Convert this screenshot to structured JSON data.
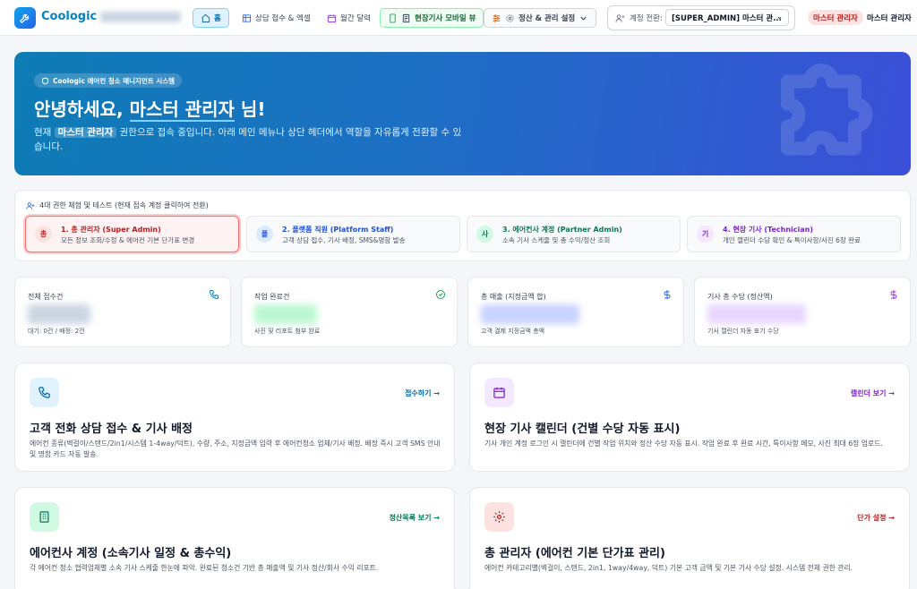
{
  "app": {
    "name": "Coologic"
  },
  "nav": {
    "home": "홈",
    "consult": "상담 접수 & 엑셀",
    "calendar": "월간 달력",
    "mobile": "현장기사 모바일 뷰",
    "settle": "정산 & 관리 설정"
  },
  "account": {
    "switch_label": "계정 전환:",
    "selected": "[SUPER_ADMIN] 마스터 관...",
    "role_badge": "마스터 관리자",
    "role_name": "마스터 관리자"
  },
  "hero": {
    "badge": "Coologic 에어컨 청소 매니지먼트 시스템",
    "greeting_prefix": "안녕하세요,",
    "greeting_name": "마스터 관리자",
    "greeting_suffix": "님!",
    "desc_prefix": "현재",
    "desc_role": "마스터 관리자",
    "desc_suffix": "권한으로 접속 중입니다. 아래 메인 메뉴나 상단 헤더에서 역할을 자유롭게 전환할 수 있습니다."
  },
  "roles": {
    "heading": "4대 권한 체험 및 테스트 (현재 접속 계정 클릭하여 전환)",
    "items": [
      {
        "dot": "총",
        "title": "1. 총 관리자 (Super Admin)",
        "desc": "모든 정보 조회/수정 & 에어컨 기본 단가표 변경",
        "color": "#b91c1c",
        "dot_bg": "#fee2e2"
      },
      {
        "dot": "플",
        "title": "2. 플랫폼 직원 (Platform Staff)",
        "desc": "고객 상담 접수, 기사 배정, SMS&명함 발송",
        "color": "#1d4ed8",
        "dot_bg": "#dbeafe"
      },
      {
        "dot": "사",
        "title": "3. 에어컨사 계정 (Partner Admin)",
        "desc": "소속 기사 스케줄 및 총 수익/정산 조회",
        "color": "#047857",
        "dot_bg": "#d1fae5"
      },
      {
        "dot": "기",
        "title": "4. 현장 기사 (Technician)",
        "desc": "개인 캘린더 수당 확인 & 특이사항/사진 6장 완료",
        "color": "#7e22ce",
        "dot_bg": "#f3e8ff"
      }
    ]
  },
  "stats": [
    {
      "label": "전체 접수건",
      "sub": "대기: 0건 / 배정: 2건",
      "icon": "phone-icon",
      "color": "#0284c7",
      "blur": "#cbd5e1"
    },
    {
      "label": "작업 완료건",
      "sub": "사진 및 리포트 첨부 완료",
      "icon": "check-circle-icon",
      "color": "#16a34a",
      "blur": "#bbf7d0"
    },
    {
      "label": "총 매출 (지정금액 합)",
      "sub": "고객 결제 지정금액 총액",
      "icon": "dollar-icon",
      "color": "#2563eb",
      "blur": "#c7d2fe"
    },
    {
      "label": "기사 총 수당 (정산액)",
      "sub": "기사 캘린더 자동 표기 수당",
      "icon": "dollar-icon",
      "color": "#9333ea",
      "blur": "#e9d5ff"
    }
  ],
  "features": [
    {
      "title": "고객 전화 상담 접수 & 기사 배정",
      "link": "접수하기 →",
      "desc": "에어컨 종류(벽걸이/스탠드/2in1/시스템 1-4way/덕트), 수량, 주소, 지정금액 입력 후 에어컨청소 업체/기사 배정. 배정 즉시 고객 SMS 안내 및 명함 카드 자동 발송.",
      "icon": "phone-icon",
      "color": "#0369a1",
      "bg": "#e0f2fe"
    },
    {
      "title": "현장 기사 캘린더 (건별 수당 자동 표시)",
      "link": "캘린더 보기 →",
      "desc": "기사 개인 계정 로그인 시 캘린더에 건별 작업 위치와 정산 수당 자동 표시. 작업 완료 후 완료 시간, 특이사항 메모, 사진 최대 6장 업로드.",
      "icon": "calendar-icon",
      "color": "#7e22ce",
      "bg": "#f3e8ff"
    },
    {
      "title": "에어컨사 계정 (소속기사 일정 & 총수익)",
      "link": "정산목록 보기 →",
      "desc": "각 에어컨 청소 협력업체별 소속 기사 스케줄 한눈에 파악. 완료된 청소건 기반 총 매출액 및 기사 정산/회사 수익 리포트.",
      "icon": "building-icon",
      "color": "#047857",
      "bg": "#d1fae5"
    },
    {
      "title": "총 관리자 (에어컨 기본 단가표 관리)",
      "link": "단가 설정 →",
      "desc": "에어컨 카테고리별(벽걸이, 스탠드, 2in1, 1way/4way, 덕트) 기본 고객 금액 및 기본 기사 수당 설정. 시스템 전체 권한 관리.",
      "icon": "gear-icon",
      "color": "#b91c1c",
      "bg": "#fee2e2"
    }
  ]
}
